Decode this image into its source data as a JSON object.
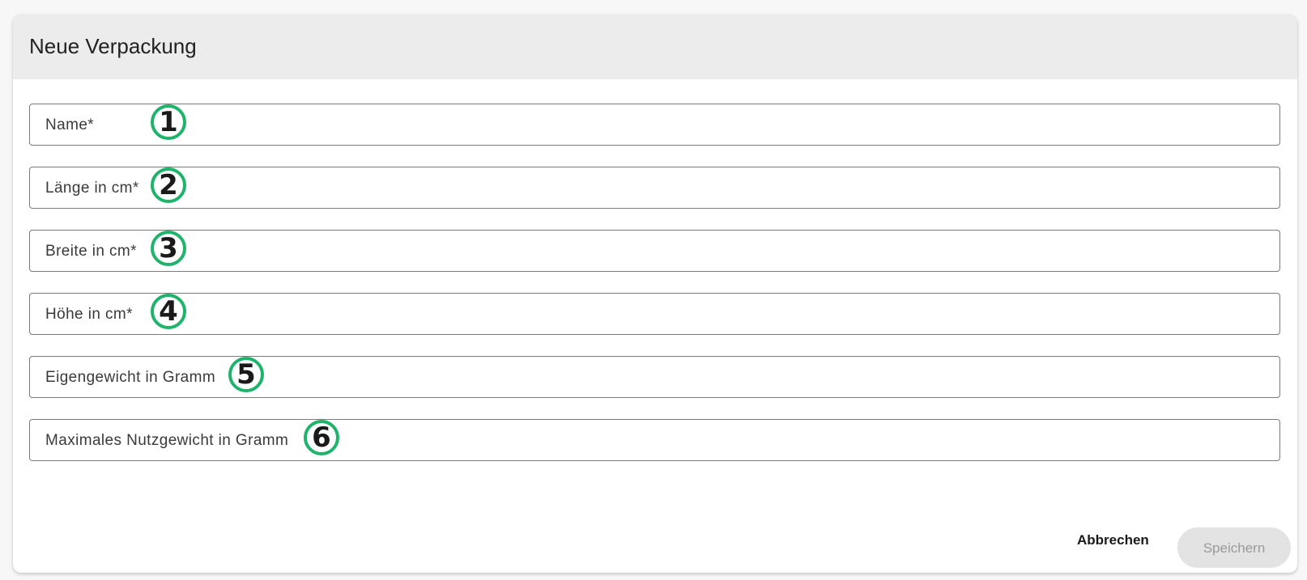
{
  "dialog": {
    "title": "Neue Verpackung"
  },
  "fields": [
    {
      "label": "Name*",
      "marker": "1"
    },
    {
      "label": "Länge in cm*",
      "marker": "2"
    },
    {
      "label": "Breite in cm*",
      "marker": "3"
    },
    {
      "label": "Höhe in cm*",
      "marker": "4"
    },
    {
      "label": "Eigengewicht in Gramm",
      "marker": "5"
    },
    {
      "label": "Maximales Nutzgewicht in Gramm",
      "marker": "6"
    }
  ],
  "actions": {
    "cancel_label": "Abbrechen",
    "save_label": "Speichern",
    "save_disabled": true
  },
  "colors": {
    "marker_ring": "#1fb36b",
    "header_bg": "#ececec",
    "save_disabled_bg": "#e3e3e3"
  }
}
